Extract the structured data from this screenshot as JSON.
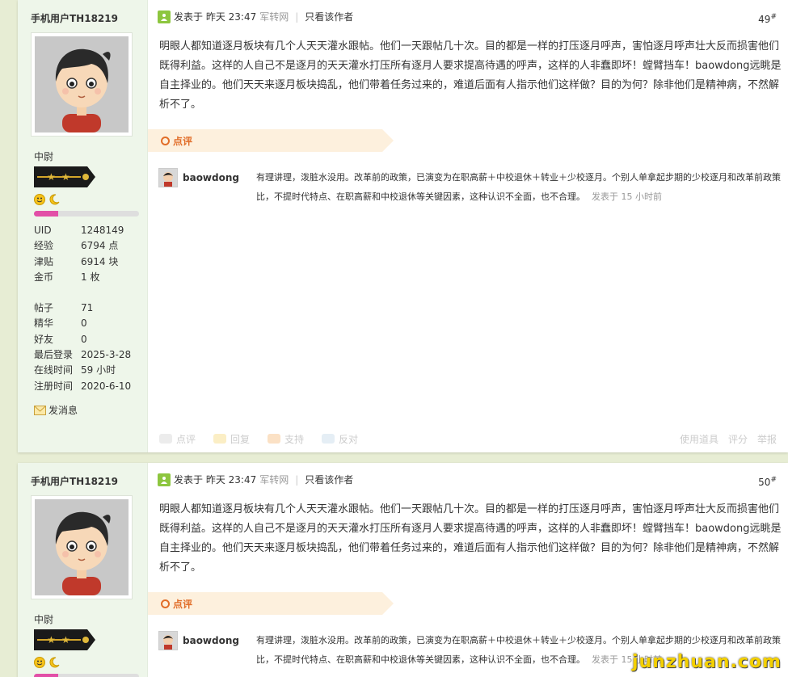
{
  "posts": [
    {
      "username": "手机用户TH18219",
      "rank": "中尉",
      "level_progress": 0.23,
      "stats": [
        {
          "k": "UID",
          "v": "1248149"
        },
        {
          "k": "经验",
          "v": "6794 点"
        },
        {
          "k": "津贴",
          "v": "6914 块"
        },
        {
          "k": "金币",
          "v": "1 枚"
        }
      ],
      "stats2": [
        {
          "k": "帖子",
          "v": "71"
        },
        {
          "k": "精华",
          "v": "0"
        },
        {
          "k": "好友",
          "v": "0"
        },
        {
          "k": "最后登录",
          "v": "2025-3-28"
        },
        {
          "k": "在线时间",
          "v": "59 小时"
        },
        {
          "k": "注册时间",
          "v": "2020-6-10"
        }
      ],
      "send_message": "发消息",
      "posted_at": "发表于 昨天 23:47",
      "source": "军转网",
      "only_author": "只看该作者",
      "floor": "49",
      "content": "明眼人都知道逐月板块有几个人天天灌水跟帖。他们一天跟帖几十次。目的都是一样的打压逐月呼声，害怕逐月呼声壮大反而损害他们既得利益。这样的人自己不是逐月的天天灌水打压所有逐月人要求提高待遇的呼声，这样的人非蠢即坏！螳臂挡车！baowdong远眺是自主择业的。他们天天来逐月板块捣乱，他们带着任务过来的，难道后面有人指示他们这样做？目的为何？除非他们是精神病，不然解析不了。",
      "dianping": "点评",
      "comment_user": "baowdong",
      "comment_text": "有理讲理，泼脏水没用。改革前的政策，已演变为在职高薪＋中校退休＋转业＋少校逐月。个别人单拿起步期的少校逐月和改革前政策比，不提时代特点、在职高薪和中校退休等关键因素，这种认识不全面，也不合理。",
      "comment_time": "发表于 15 小时前",
      "actions": [
        "点评",
        "回复",
        "支持",
        "反对"
      ],
      "actions_right": [
        "使用道具",
        "评分",
        "举报"
      ]
    },
    {
      "username": "手机用户TH18219",
      "rank": "中尉",
      "level_progress": 0.23,
      "posted_at": "发表于 昨天 23:47",
      "source": "军转网",
      "only_author": "只看该作者",
      "floor": "50",
      "content": "明眼人都知道逐月板块有几个人天天灌水跟帖。他们一天跟帖几十次。目的都是一样的打压逐月呼声，害怕逐月呼声壮大反而损害他们既得利益。这样的人自己不是逐月的天天灌水打压所有逐月人要求提高待遇的呼声，这样的人非蠢即坏！螳臂挡车！baowdong远眺是自主择业的。他们天天来逐月板块捣乱，他们带着任务过来的，难道后面有人指示他们这样做？目的为何？除非他们是精神病，不然解析不了。",
      "dianping": "点评",
      "comment_user": "baowdong",
      "comment_text": "有理讲理，泼脏水没用。改革前的政策，已演变为在职高薪＋中校退休＋转业＋少校逐月。个别人单拿起步期的少校逐月和改革前政策比，不提时代特点、在职高薪和中校退休等关键因素，这种认识不全面，也不合理。",
      "comment_time": "发表于 15 小时前"
    }
  ],
  "watermark": "junzhuan.com",
  "colors": {
    "accent": "#e16d28",
    "page_bg": "#e7edd4",
    "sidebar_bg": "#eef6ea",
    "progress": "#e24fa7"
  }
}
